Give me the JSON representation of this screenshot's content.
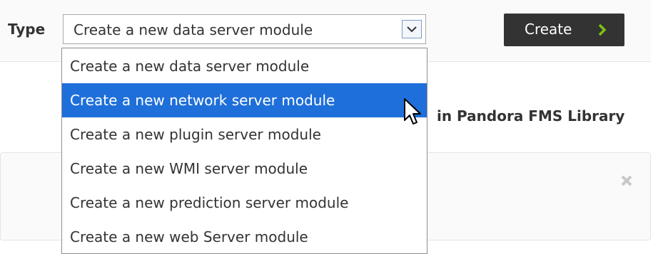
{
  "form": {
    "type_label": "Type",
    "selected_value": "Create a new data server module",
    "create_button_label": "Create"
  },
  "dropdown": {
    "options": [
      "Create a new data server module",
      "Create a new network server module",
      "Create a new plugin server module",
      "Create a new WMI server module",
      "Create a new prediction server module",
      "Create a new web Server module"
    ],
    "highlighted_index": 1
  },
  "library_text": "in Pandora FMS Library",
  "colors": {
    "accent": "#1e6fd9",
    "button_bg": "#333333",
    "chevron": "#7cc30f"
  },
  "icons": [
    "chevron-down-icon",
    "chevron-right-icon",
    "close-icon",
    "cursor-icon"
  ]
}
